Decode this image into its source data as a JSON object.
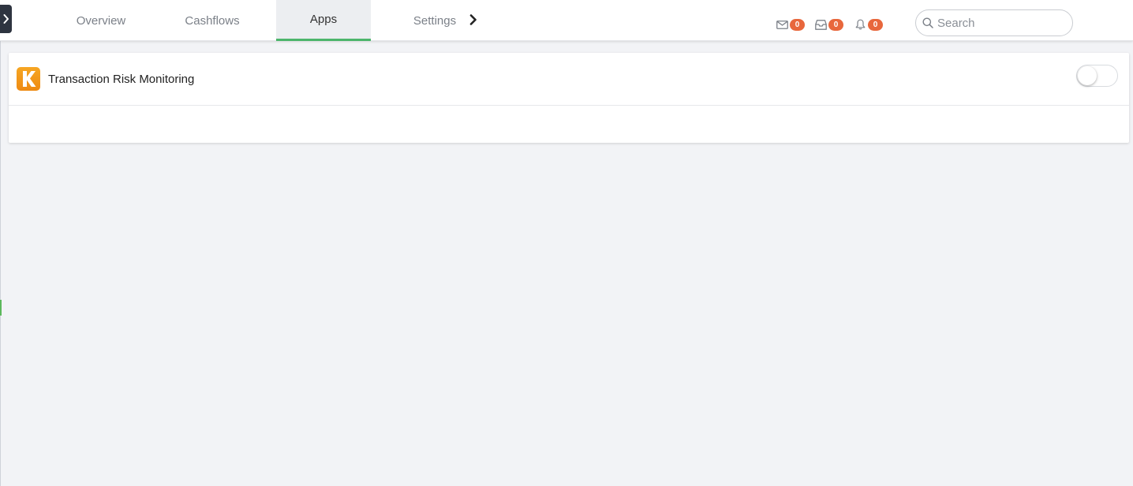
{
  "tabs": [
    {
      "label": "Overview"
    },
    {
      "label": "Cashflows"
    },
    {
      "label": "Apps",
      "active": true
    },
    {
      "label": "Settings"
    }
  ],
  "notifications": {
    "messages": {
      "icon": "mail-icon",
      "count": "0"
    },
    "inbox": {
      "icon": "inbox-icon",
      "count": "0"
    },
    "alerts": {
      "icon": "bell-icon",
      "count": "0"
    }
  },
  "search": {
    "placeholder": "Search",
    "value": ""
  },
  "apps": [
    {
      "name": "Transaction Risk Monitoring",
      "logo_letter": "K",
      "enabled": false
    }
  ],
  "colors": {
    "accent": "#4cb56b",
    "badge": "#e8673c",
    "logo": "#f29a1c",
    "sidebar_toggle": "#2e3440",
    "background": "#f2f3f6"
  }
}
